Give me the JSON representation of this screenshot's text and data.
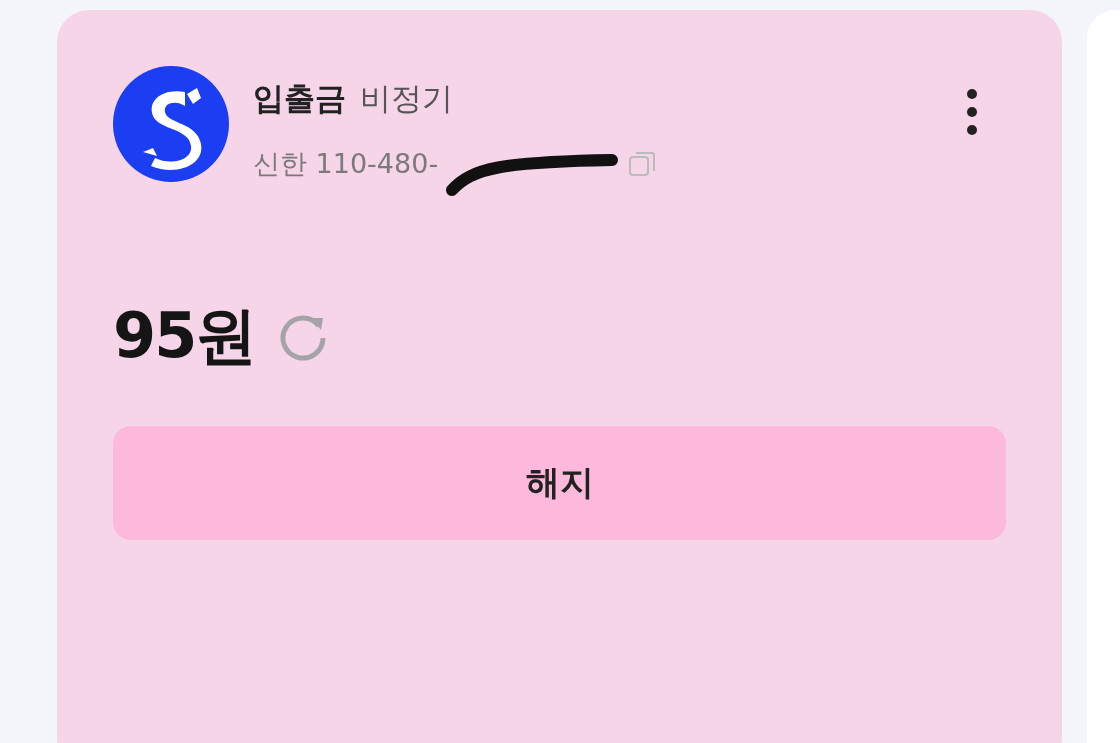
{
  "account": {
    "type": "입출금",
    "tag": "비정기",
    "bank_line": "신한 110-480-"
  },
  "balance": {
    "amount": "95원"
  },
  "actions": [
    {
      "label": "해지"
    }
  ]
}
